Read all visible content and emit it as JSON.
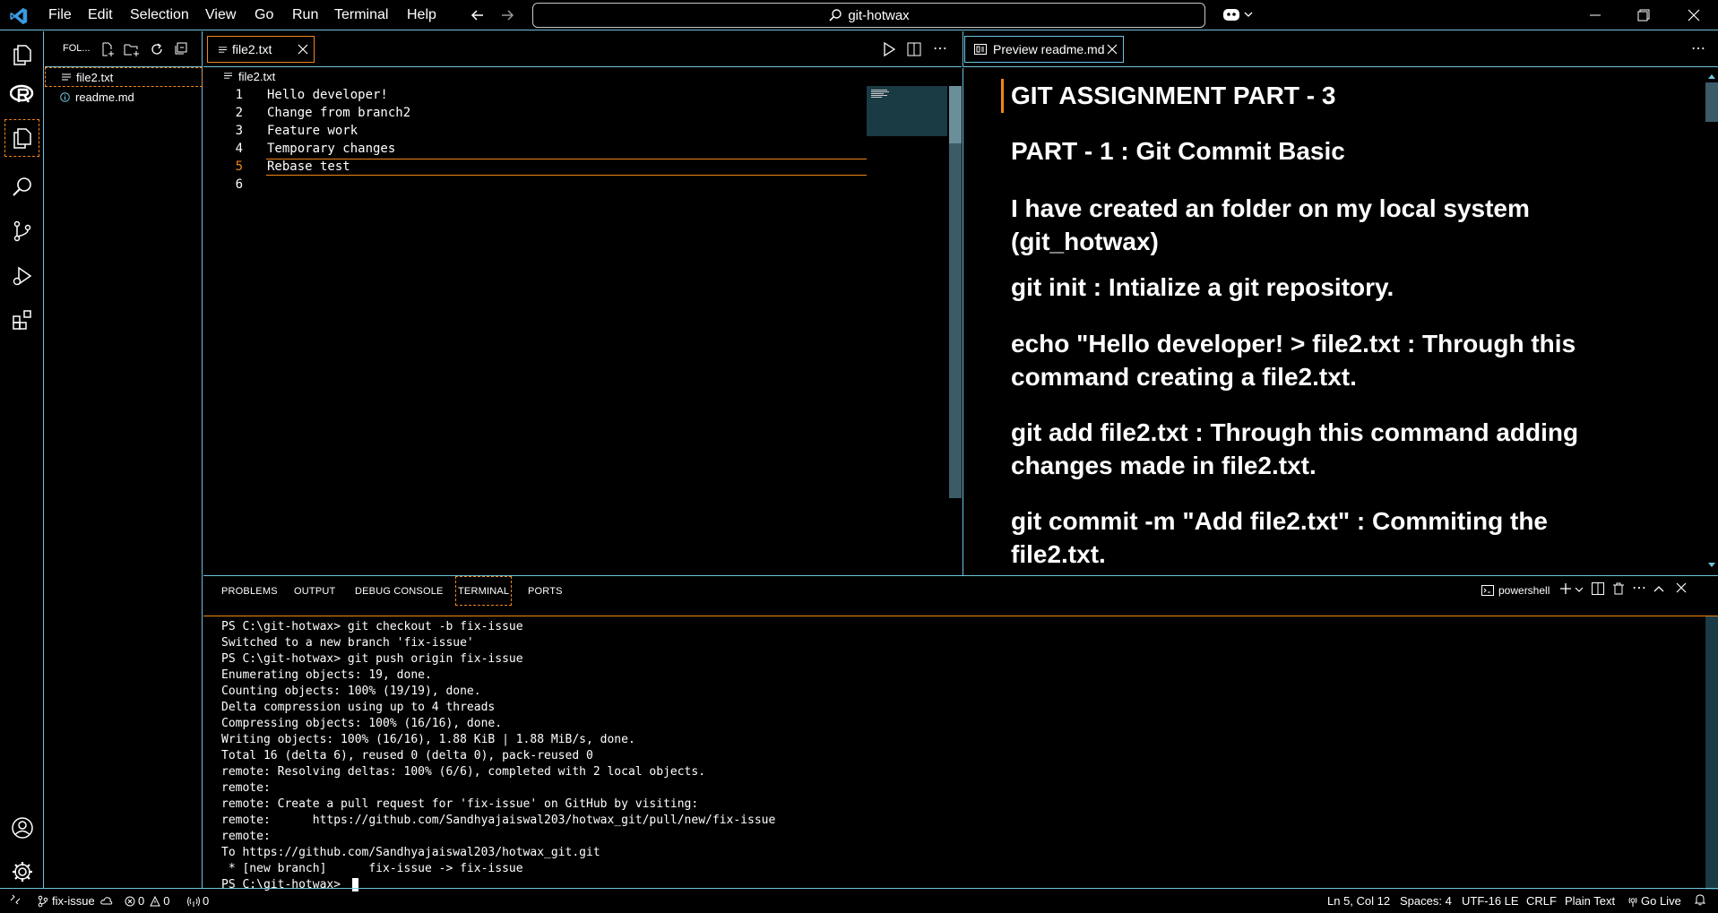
{
  "titlebar": {
    "menu": [
      "File",
      "Edit",
      "Selection",
      "View",
      "Go",
      "Run",
      "Terminal",
      "Help"
    ],
    "search_text": "git-hotwax"
  },
  "sidebar": {
    "header": "FOL...",
    "files": [
      {
        "name": "file2.txt",
        "icon": "lines-icon"
      },
      {
        "name": "readme.md",
        "icon": "info-icon"
      }
    ]
  },
  "editor": {
    "tab_label": "file2.txt",
    "breadcrumb": "file2.txt",
    "lines": [
      {
        "n": "1",
        "text": "Hello developer!"
      },
      {
        "n": "2",
        "text": "Change from branch2"
      },
      {
        "n": "3",
        "text": "Feature work"
      },
      {
        "n": "4",
        "text": "Temporary changes"
      },
      {
        "n": "5",
        "text": "Rebase test"
      },
      {
        "n": "6",
        "text": ""
      }
    ],
    "active_line": 5
  },
  "preview": {
    "tab_label": "Preview readme.md",
    "blocks": [
      "GIT ASSIGNMENT PART - 3",
      "PART - 1 : Git Commit Basic",
      "I have created an folder on my local system (git_hotwax)",
      "git init : Intialize a git repository.",
      "echo \"Hello developer! > file2.txt : Through this command creating a file2.txt.",
      "git add file2.txt : Through this command adding changes made in file2.txt.",
      "git commit -m \"Add file2.txt\" : Commiting the file2.txt."
    ]
  },
  "panel": {
    "tabs": [
      "PROBLEMS",
      "OUTPUT",
      "DEBUG CONSOLE",
      "TERMINAL",
      "PORTS"
    ],
    "active_tab": "TERMINAL",
    "shell": "powershell",
    "terminal_lines": [
      "PS C:\\git-hotwax> git checkout -b fix-issue",
      "Switched to a new branch 'fix-issue'",
      "PS C:\\git-hotwax> git push origin fix-issue",
      "Enumerating objects: 19, done.",
      "Counting objects: 100% (19/19), done.",
      "Delta compression using up to 4 threads",
      "Compressing objects: 100% (16/16), done.",
      "Writing objects: 100% (16/16), 1.88 KiB | 1.88 MiB/s, done.",
      "Total 16 (delta 6), reused 0 (delta 0), pack-reused 0",
      "remote: Resolving deltas: 100% (6/6), completed with 2 local objects.",
      "remote:",
      "remote: Create a pull request for 'fix-issue' on GitHub by visiting:",
      "remote:      https://github.com/Sandhyajaiswal203/hotwax_git/pull/new/fix-issue",
      "remote:",
      "To https://github.com/Sandhyajaiswal203/hotwax_git.git",
      " * [new branch]      fix-issue -> fix-issue",
      "PS C:\\git-hotwax> "
    ]
  },
  "statusbar": {
    "branch": "fix-issue",
    "errors": "0",
    "warnings": "0",
    "ports": "0",
    "position": "Ln 5, Col 12",
    "spaces": "Spaces: 4",
    "encoding": "UTF-16 LE",
    "eol": "CRLF",
    "language": "Plain Text",
    "golive": "Go Live"
  },
  "colors": {
    "border": "#6fc3df",
    "focus": "#f38518",
    "background": "#000000"
  }
}
